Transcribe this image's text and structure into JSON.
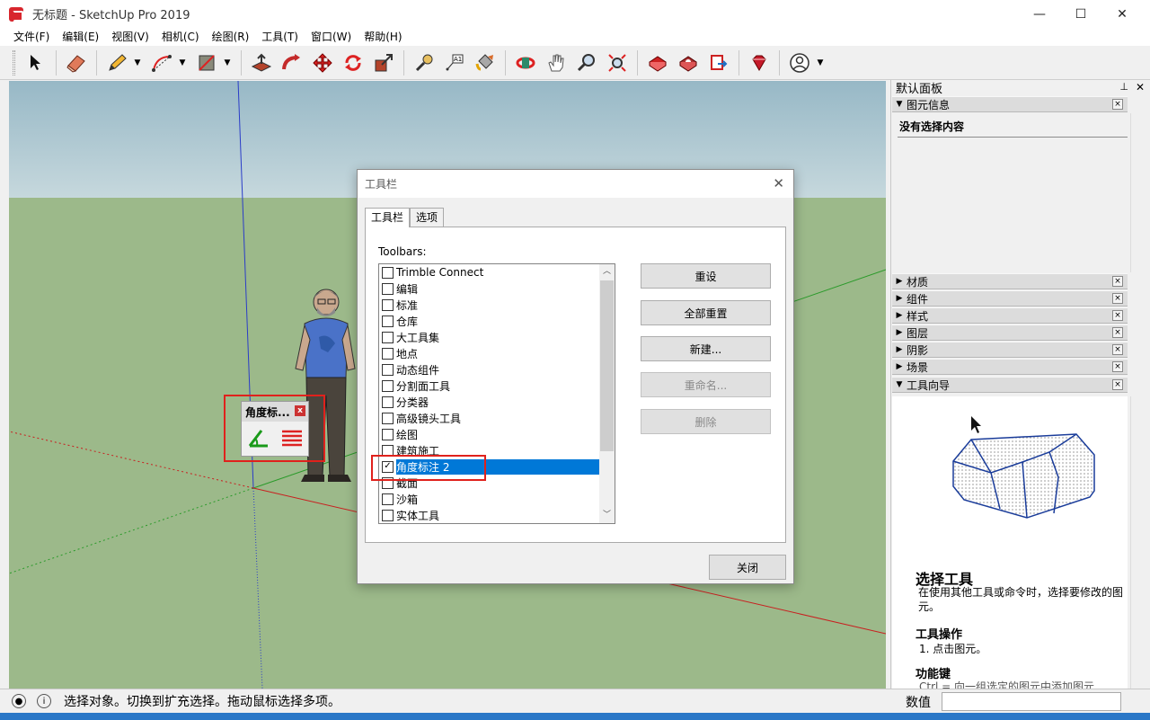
{
  "window": {
    "title": "无标题 - SketchUp Pro 2019",
    "minimize": "—",
    "maximize": "☐",
    "close": "✕"
  },
  "menu": [
    "文件(F)",
    "编辑(E)",
    "视图(V)",
    "相机(C)",
    "绘图(R)",
    "工具(T)",
    "窗口(W)",
    "帮助(H)"
  ],
  "toolbar": {
    "icons": [
      "select-icon",
      "eraser-icon",
      "pencil-icon",
      "arc-icon",
      "shape-icon",
      "push-pull-icon",
      "follow-me-icon",
      "move-icon",
      "rotate-icon",
      "scale-icon",
      "tape-measure-icon",
      "text-icon",
      "paint-bucket-icon",
      "orbit-icon",
      "pan-icon",
      "zoom-icon",
      "zoom-extents-icon",
      "warehouse-icon",
      "extension-icon",
      "send-to-layout-icon",
      "ruby-icon",
      "account-icon"
    ]
  },
  "mini_toolbar": {
    "title": "角度标...",
    "close": "x"
  },
  "dialog": {
    "title": "工具栏",
    "close": "✕",
    "tabs": [
      "工具栏",
      "选项"
    ],
    "list_label": "Toolbars:",
    "items": [
      {
        "label": "Trimble Connect",
        "checked": false,
        "selected": false
      },
      {
        "label": "编辑",
        "checked": false,
        "selected": false
      },
      {
        "label": "标准",
        "checked": false,
        "selected": false
      },
      {
        "label": "仓库",
        "checked": false,
        "selected": false
      },
      {
        "label": "大工具集",
        "checked": false,
        "selected": false
      },
      {
        "label": "地点",
        "checked": false,
        "selected": false
      },
      {
        "label": "动态组件",
        "checked": false,
        "selected": false
      },
      {
        "label": "分割面工具",
        "checked": false,
        "selected": false
      },
      {
        "label": "分类器",
        "checked": false,
        "selected": false
      },
      {
        "label": "高级镜头工具",
        "checked": false,
        "selected": false
      },
      {
        "label": "绘图",
        "checked": false,
        "selected": false
      },
      {
        "label": "建筑施工",
        "checked": false,
        "selected": false
      },
      {
        "label": "角度标注 2",
        "checked": true,
        "selected": true
      },
      {
        "label": "截面",
        "checked": false,
        "selected": false
      },
      {
        "label": "沙箱",
        "checked": false,
        "selected": false
      },
      {
        "label": "实体工具",
        "checked": false,
        "selected": false
      }
    ],
    "buttons": [
      {
        "label": "重设",
        "disabled": false
      },
      {
        "label": "全部重置",
        "disabled": false
      },
      {
        "label": "新建...",
        "disabled": false
      },
      {
        "label": "重命名...",
        "disabled": true
      },
      {
        "label": "删除",
        "disabled": true
      }
    ],
    "close_button": "关闭"
  },
  "tray": {
    "title": "默认面板",
    "pin": "⊥",
    "close": "✕",
    "entity_info": {
      "title": "图元信息",
      "content": "没有选择内容"
    },
    "panels": [
      "材质",
      "组件",
      "样式",
      "图层",
      "阴影",
      "场景"
    ],
    "instructor": {
      "title": "工具向导",
      "heading": "选择工具",
      "desc": "在使用其他工具或命令时，选择要修改的图元。",
      "h2": "工具操作",
      "p2": "1. 点击图元。",
      "h3": "功能键",
      "p3": "Ctrl = 向一组选定的图元中添加图元"
    },
    "panel_close": "×"
  },
  "status": {
    "text": "选择对象。切换到扩充选择。拖动鼠标选择多项。",
    "measurements_label": "数值",
    "info_icon": "i"
  },
  "colors": {
    "sky": "#a0bcc4",
    "ground": "#9cb98a",
    "selection": "#0078d7",
    "highlight_red": "#e0211c"
  }
}
